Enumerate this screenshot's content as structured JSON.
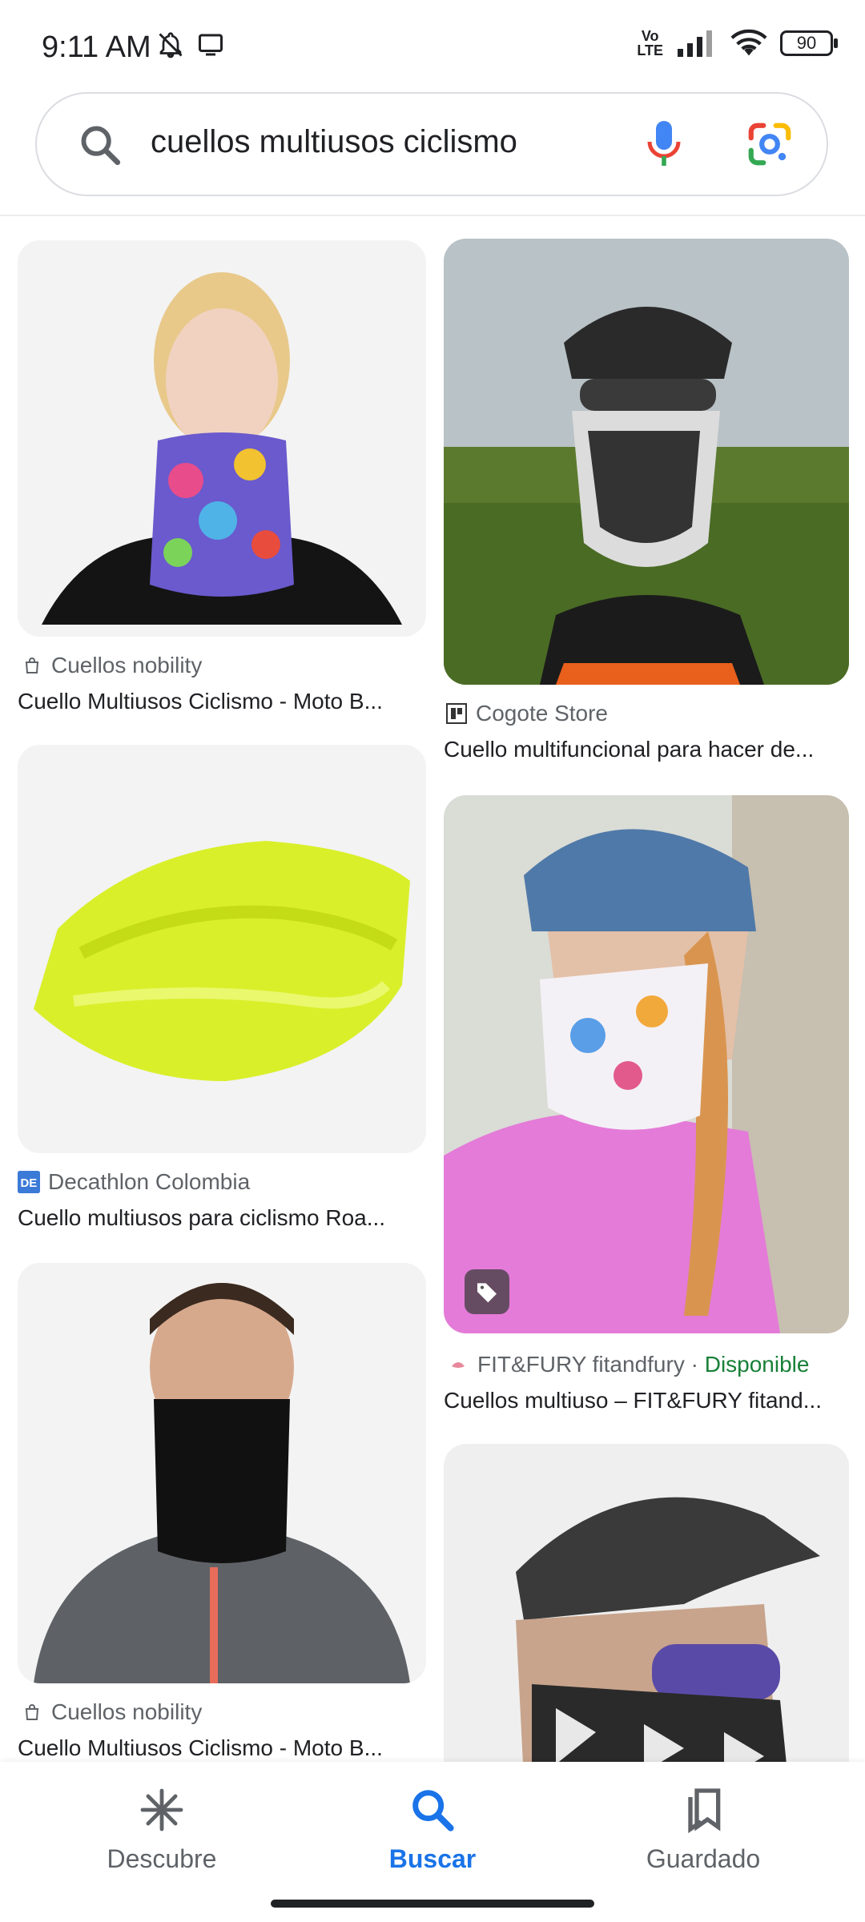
{
  "status_bar": {
    "time": "9:11 AM",
    "network_label_top": "Vo",
    "network_label_bottom": "LTE",
    "battery": "90"
  },
  "search": {
    "query": "cuellos multiusos ciclismo"
  },
  "results": [
    {
      "source": "Cuellos nobility",
      "title": "Cuello Multiusos Ciclismo - Moto B...",
      "source_icon": "bag-icon"
    },
    {
      "source": "Cogote Store",
      "title": "Cuello multifuncional para hacer de...",
      "source_icon": "store-logo-icon"
    },
    {
      "source": "Decathlon Colombia",
      "title": "Cuello multiusos para ciclismo Roa...",
      "source_icon": "decathlon-logo-icon"
    },
    {
      "source": "FIT&FURY fitandfury",
      "separator": " · ",
      "availability": "Disponible",
      "title": "Cuellos multiuso – FIT&FURY fitand...",
      "source_icon": "fitfury-logo-icon"
    },
    {
      "source": "Cuellos nobility",
      "title": "Cuello Multiusos Ciclismo - Moto B...",
      "source_icon": "bag-icon"
    }
  ],
  "bottom_nav": {
    "items": [
      {
        "label": "Descubre",
        "icon": "asterisk-icon"
      },
      {
        "label": "Buscar",
        "icon": "search-icon",
        "active": true
      },
      {
        "label": "Guardado",
        "icon": "bookmarks-icon"
      }
    ]
  },
  "colors": {
    "accent": "#1a73e8",
    "available": "#188038"
  }
}
